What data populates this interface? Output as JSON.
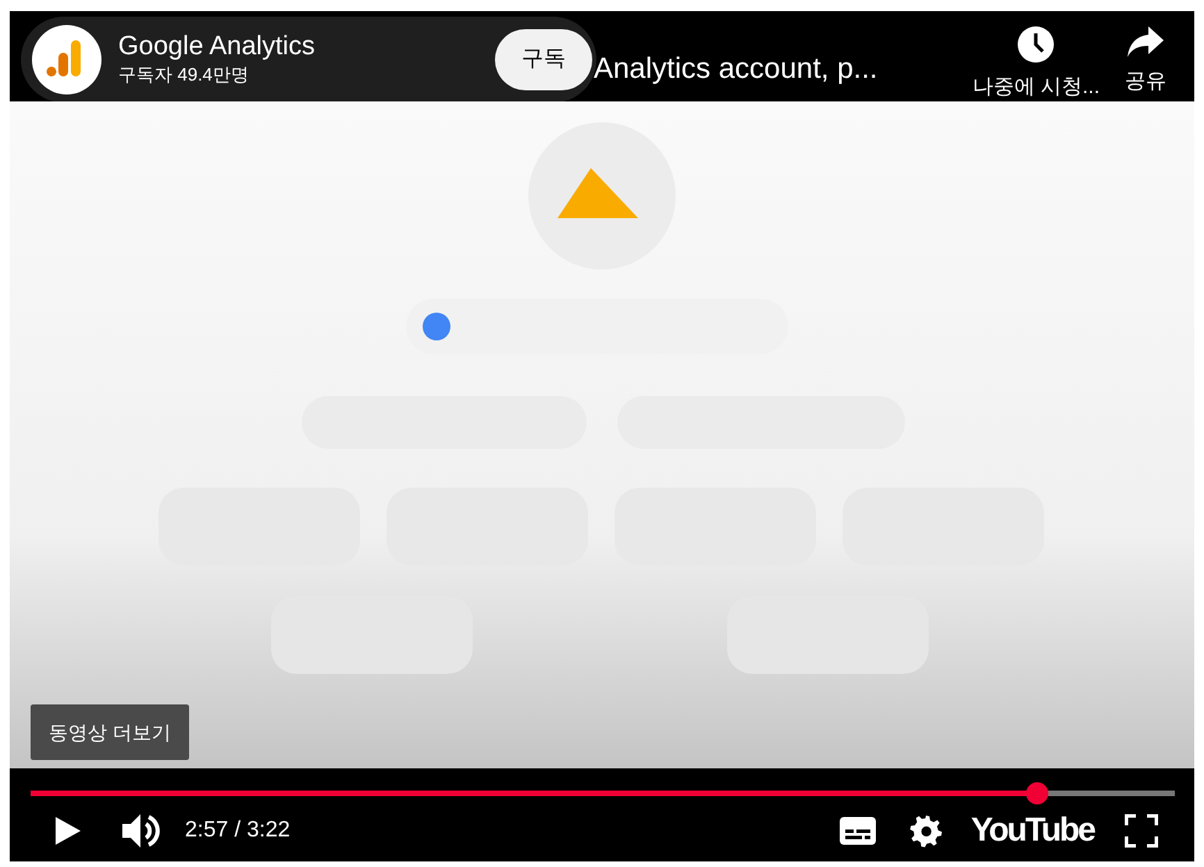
{
  "channel": {
    "name": "Google Analytics",
    "subscribers": "구독자 49.4만명",
    "subscribe_button": "구독"
  },
  "video_title": "Analytics account, p...",
  "top_actions": [
    {
      "kind": "watch_later",
      "label": "나중에 시청..."
    },
    {
      "kind": "share",
      "label": "공유"
    }
  ],
  "more_videos_button": "동영상 더보기",
  "progress": {
    "level": 0.88
  },
  "controls": {
    "time": "2:57 / 3:22",
    "logo": "YouTube"
  }
}
